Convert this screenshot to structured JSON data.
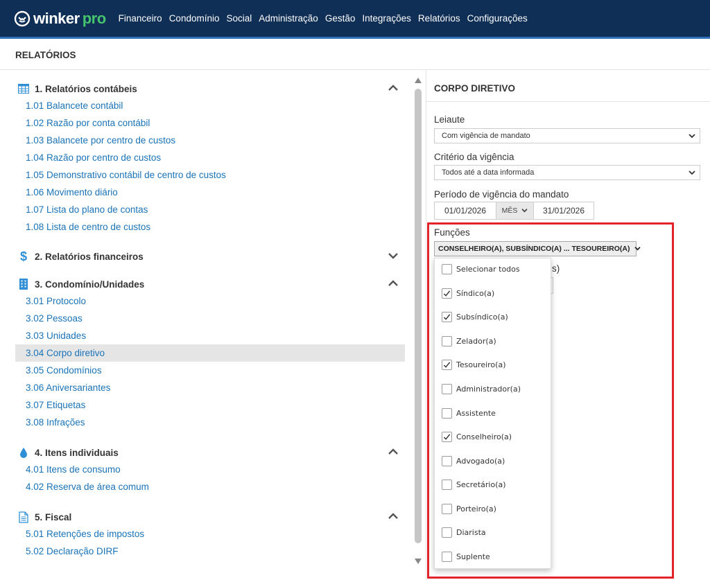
{
  "brand": {
    "name": "winker",
    "suffix": "pro",
    "accent": "#46c46d",
    "navbar_color": "#0f2f56"
  },
  "nav": [
    "Financeiro",
    "Condomínio",
    "Social",
    "Administração",
    "Gestão",
    "Integrações",
    "Relatórios",
    "Configurações"
  ],
  "page_title": "RELATÓRIOS",
  "sections": [
    {
      "title": "1. Relatórios contábeis",
      "icon": "spreadsheet-icon",
      "expanded": true,
      "items": [
        "1.01 Balancete contábil",
        "1.02 Razão por conta contábil",
        "1.03 Balancete por centro de custos",
        "1.04 Razão por centro de custos",
        "1.05 Demonstrativo contábil de centro de custos",
        "1.06 Movimento diário",
        "1.07 Lista do plano de contas",
        "1.08 Lista de centro de custos"
      ]
    },
    {
      "title": "2. Relatórios financeiros",
      "icon": "dollar-icon",
      "expanded": false,
      "items": []
    },
    {
      "title": "3. Condomínio/Unidades",
      "icon": "building-icon",
      "expanded": true,
      "items": [
        "3.01 Protocolo",
        "3.02 Pessoas",
        "3.03 Unidades",
        "3.04 Corpo diretivo",
        "3.05 Condomínios",
        "3.06 Aniversariantes",
        "3.07 Etiquetas",
        "3.08 Infrações"
      ]
    },
    {
      "title": "4. Itens individuais",
      "icon": "drop-icon",
      "expanded": true,
      "items": [
        "4.01 Itens de consumo",
        "4.02 Reserva de área comum"
      ]
    },
    {
      "title": "5. Fiscal",
      "icon": "document-icon",
      "expanded": true,
      "items": [
        "5.01 Retenções de impostos",
        "5.02 Declaração DIRF"
      ]
    }
  ],
  "active_item": "3.04 Corpo diretivo",
  "form": {
    "title": "CORPO DIRETIVO",
    "leiaute_label": "Leiaute",
    "leiaute_value": "Com vigência de mandato",
    "criterio_label": "Critério da vigência",
    "criterio_value": "Todos até a data informada",
    "periodo_label": "Período de vigência do mandato",
    "date_start": "01/01/2026",
    "mes_label": "MÊS",
    "date_end": "31/01/2026",
    "funcoes_label": "Funções",
    "funcoes_value": "CONSELHEIRO(A), SUBSÍNDICO(A) ... TESOUREIRO(A)",
    "hidden_label_fragment": "s)"
  },
  "funcoes_options": [
    {
      "label": "Selecionar todos",
      "checked": false
    },
    {
      "label": "Síndico(a)",
      "checked": true
    },
    {
      "label": "Subsíndico(a)",
      "checked": true
    },
    {
      "label": "Zelador(a)",
      "checked": false
    },
    {
      "label": "Tesoureiro(a)",
      "checked": true
    },
    {
      "label": "Administrador(a)",
      "checked": false
    },
    {
      "label": "Assistente",
      "checked": false
    },
    {
      "label": "Conselheiro(a)",
      "checked": true
    },
    {
      "label": "Advogado(a)",
      "checked": false
    },
    {
      "label": "Secretário(a)",
      "checked": false
    },
    {
      "label": "Porteiro(a)",
      "checked": false
    },
    {
      "label": "Diarista",
      "checked": false
    },
    {
      "label": "Suplente",
      "checked": false
    }
  ]
}
